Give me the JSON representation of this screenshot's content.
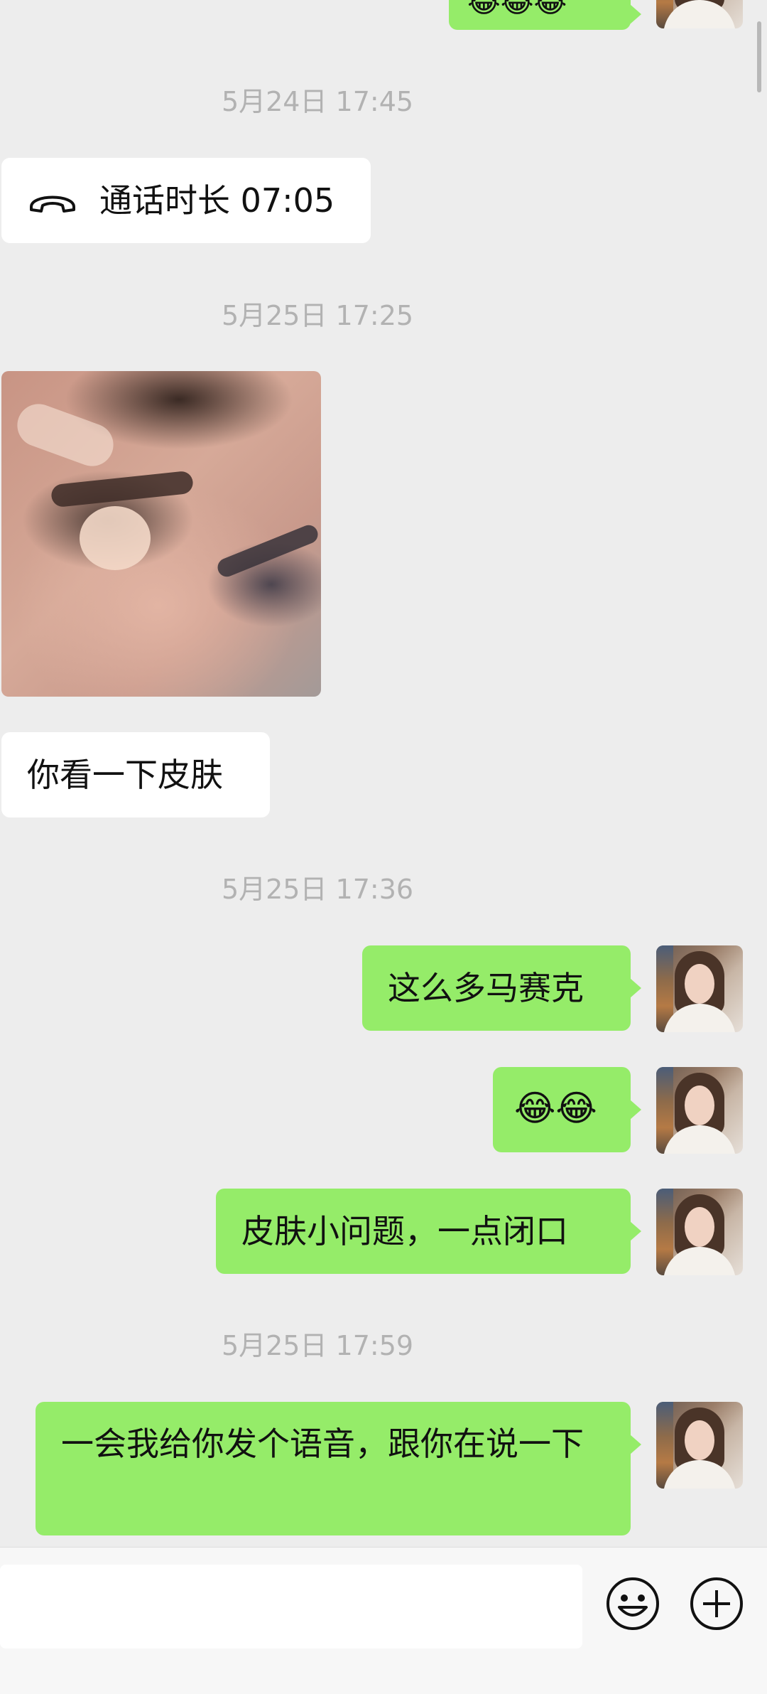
{
  "colors": {
    "bg": "#ededed",
    "me_bubble": "#95ec69",
    "them_bubble": "#ffffff",
    "timestamp": "#b2b2b2"
  },
  "top_partial": {
    "text": "😂😂😂"
  },
  "messages": [
    {
      "type": "timestamp",
      "text": "5月24日 17:45"
    },
    {
      "type": "call",
      "text": "通话时长 07:05",
      "icon": "phone-hangup-icon"
    },
    {
      "type": "timestamp",
      "text": "5月25日 17:25"
    },
    {
      "type": "image",
      "alt": "face-photo"
    },
    {
      "type": "text",
      "text": "你看一下皮肤"
    },
    {
      "type": "timestamp",
      "text": "5月25日 17:36"
    },
    {
      "type": "text",
      "text": "这么多马赛克"
    },
    {
      "type": "text",
      "text": "😂😂"
    },
    {
      "type": "text",
      "text": "皮肤小问题，一点闭口"
    },
    {
      "type": "timestamp",
      "text": "5月25日 17:59"
    },
    {
      "type": "text",
      "text": "一会我给你发个语音，跟你在说一下"
    }
  ],
  "input_bar": {
    "value": "",
    "emoji_icon": "emoji-icon",
    "plus_icon": "plus-icon"
  }
}
